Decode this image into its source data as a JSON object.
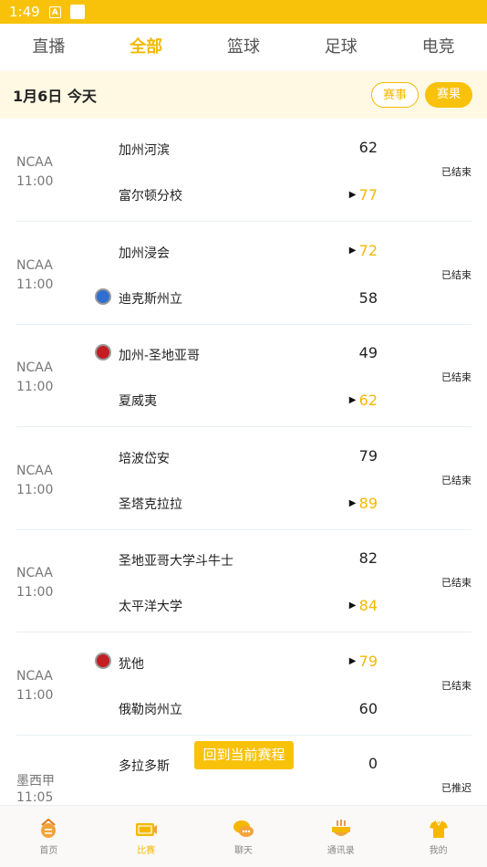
{
  "status_bar": {
    "time": "1:49",
    "a_glyph": "A"
  },
  "top_tabs": [
    {
      "label": "直播",
      "active": false
    },
    {
      "label": "全部",
      "active": true
    },
    {
      "label": "篮球",
      "active": false
    },
    {
      "label": "足球",
      "active": false
    },
    {
      "label": "电竞",
      "active": false
    }
  ],
  "date_bar": {
    "date": "1月6日 今天",
    "btn_events": "赛事",
    "btn_fav": "赛果"
  },
  "matches": [
    {
      "league": "NCAA",
      "time": "11:00",
      "home": "加州河滨",
      "away": "富尔顿分校",
      "home_score": "62",
      "away_score": "77",
      "winner": "away",
      "status": "已结束",
      "home_badge": null,
      "away_badge": null
    },
    {
      "league": "NCAA",
      "time": "11:00",
      "home": "加州浸会",
      "away": "迪克斯州立",
      "home_score": "72",
      "away_score": "58",
      "winner": "home",
      "status": "已结束",
      "home_badge": null,
      "away_badge": "#2f6fd1"
    },
    {
      "league": "NCAA",
      "time": "11:00",
      "home": "加州-圣地亚哥",
      "away": "夏威夷",
      "home_score": "49",
      "away_score": "62",
      "winner": "away",
      "status": "已结束",
      "home_badge": "#c41e23",
      "away_badge": null
    },
    {
      "league": "NCAA",
      "time": "11:00",
      "home": "培波岱安",
      "away": "圣塔克拉拉",
      "home_score": "79",
      "away_score": "89",
      "winner": "away",
      "status": "已结束",
      "home_badge": null,
      "away_badge": null
    },
    {
      "league": "NCAA",
      "time": "11:00",
      "home": "圣地亚哥大学斗牛士",
      "away": "太平洋大学",
      "home_score": "82",
      "away_score": "84",
      "winner": "away",
      "status": "已结束",
      "home_badge": null,
      "away_badge": null
    },
    {
      "league": "NCAA",
      "time": "11:00",
      "home": "犹他",
      "away": "俄勒岗州立",
      "home_score": "79",
      "away_score": "60",
      "winner": "home",
      "status": "已结束",
      "home_badge": "#c41e23",
      "away_badge": null
    },
    {
      "league": "墨西甲",
      "time": "11:05",
      "home": "多拉多斯",
      "away": "",
      "home_score": "0",
      "away_score": "",
      "winner": null,
      "status": "已推迟",
      "home_badge": null,
      "away_badge": null
    }
  ],
  "back_button": "回到当前赛程",
  "bottom_nav": [
    {
      "label": "首页",
      "icon": "home-icon",
      "active": false
    },
    {
      "label": "比赛",
      "icon": "match-icon",
      "active": true
    },
    {
      "label": "聊天",
      "icon": "chat-icon",
      "active": false
    },
    {
      "label": "通讯录",
      "icon": "contacts-icon",
      "active": false
    },
    {
      "label": "我的",
      "icon": "profile-icon",
      "active": false
    }
  ],
  "colors": {
    "accent": "#f9c20a",
    "accent_text": "#f5b800",
    "date_bar_bg": "#fff8e3"
  }
}
